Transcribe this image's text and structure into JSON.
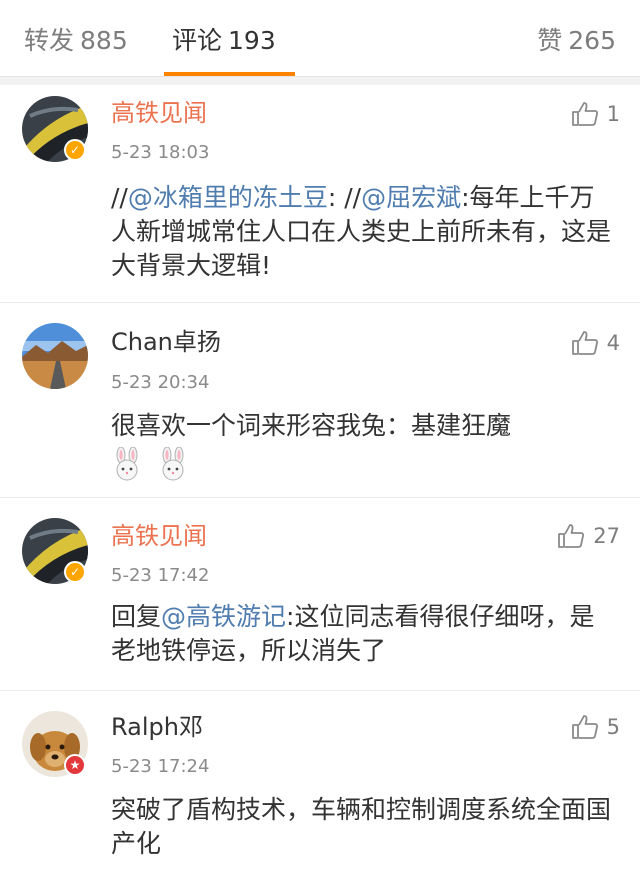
{
  "tabs": {
    "repost": {
      "label": "转发",
      "count": "885"
    },
    "comment": {
      "label": "评论",
      "count": "193"
    },
    "like": {
      "label": "赞",
      "count": "265"
    }
  },
  "accent_color": "#ff8200",
  "username_vip_color": "#eb7350",
  "mention_color": "#507daf",
  "comments": [
    {
      "username": "高铁见闻",
      "time": "5-23 18:03",
      "likes": "1",
      "badge": "verified",
      "text": {
        "p1": "//",
        "m1": "@冰箱里的冻土豆",
        "p2": ": //",
        "m2": "@屈宏斌",
        "p3": ":每年上千万人新增城常住人口在人类史上前所未有，这是大背景大逻辑!"
      }
    },
    {
      "username": "Chan卓扬",
      "time": "5-23 20:34",
      "likes": "4",
      "text": {
        "p1": "很喜欢一个词来形容我兔：基建狂魔"
      },
      "emoji": [
        "rabbit-emoji",
        "rabbit-emoji"
      ]
    },
    {
      "username": "高铁见闻",
      "time": "5-23 17:42",
      "likes": "27",
      "badge": "verified",
      "text": {
        "p1": "回复",
        "m1": "@高铁游记",
        "p2": ":这位同志看得很仔细呀，是老地铁停运，所以消失了"
      }
    },
    {
      "username": "Ralph邓",
      "time": "5-23 17:24",
      "likes": "5",
      "badge": "star",
      "text": {
        "p1": "突破了盾构技术，车辆和控制调度系统全面国产化"
      }
    }
  ]
}
